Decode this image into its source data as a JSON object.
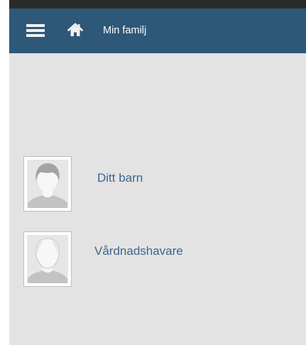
{
  "appbar": {
    "menu_icon": "menu-icon",
    "home_icon": "home-icon",
    "title": "Min familj",
    "background": "#2e5878"
  },
  "list": [
    {
      "label": "Ditt barn",
      "avatar_icon": "child-avatar-icon"
    },
    {
      "label": "Vårdnadshavare",
      "avatar_icon": "guardian-avatar-icon"
    }
  ],
  "colors": {
    "content_background": "#e3e3e3",
    "link_text": "#3e6688"
  }
}
